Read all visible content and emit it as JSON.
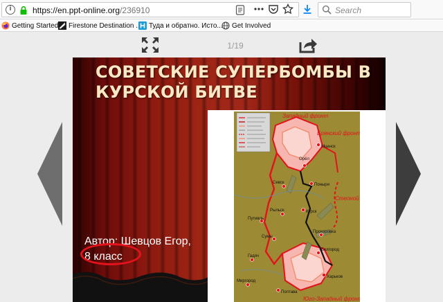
{
  "browser": {
    "url_host": "https://en.ppt-online.org",
    "url_path": "/236910",
    "search_placeholder": "Search"
  },
  "bookmarks": [
    {
      "label": "Getting Started",
      "icon": "firefox-icon"
    },
    {
      "label": "Firestone Destination ...",
      "icon": "firestone-icon"
    },
    {
      "label": "Туда и обратно. Исто...",
      "icon": "h-icon"
    },
    {
      "label": "Get Involved",
      "icon": "globe-icon"
    }
  ],
  "viewer": {
    "page_counter": "1/19"
  },
  "slide": {
    "title": "СОВЕТСКИЕ СУПЕРБОМБЫ В КУРСКОЙ БИТВЕ",
    "author": "Автор: Шевцов Егор,",
    "class": "8 класс"
  },
  "map": {
    "fronts": [
      "Западный фронт",
      "Брянский фронт",
      "Степной фронт",
      "Юго-Западный фронт"
    ],
    "cities": [
      "Мценск",
      "Орёл",
      "Поныри",
      "Севск",
      "Рыльск",
      "Курск",
      "Путивль",
      "Прохоровка",
      "Сумы",
      "Белгород",
      "Гадяч",
      "Харьков",
      "Миргород",
      "Полтава"
    ]
  },
  "colors": {
    "curtain_red": "#9e2414",
    "title_text": "#fbe9c6",
    "highlight_ellipse": "#e4121b",
    "map_bg": "#9c8a35",
    "front_line": "#e4121b"
  }
}
